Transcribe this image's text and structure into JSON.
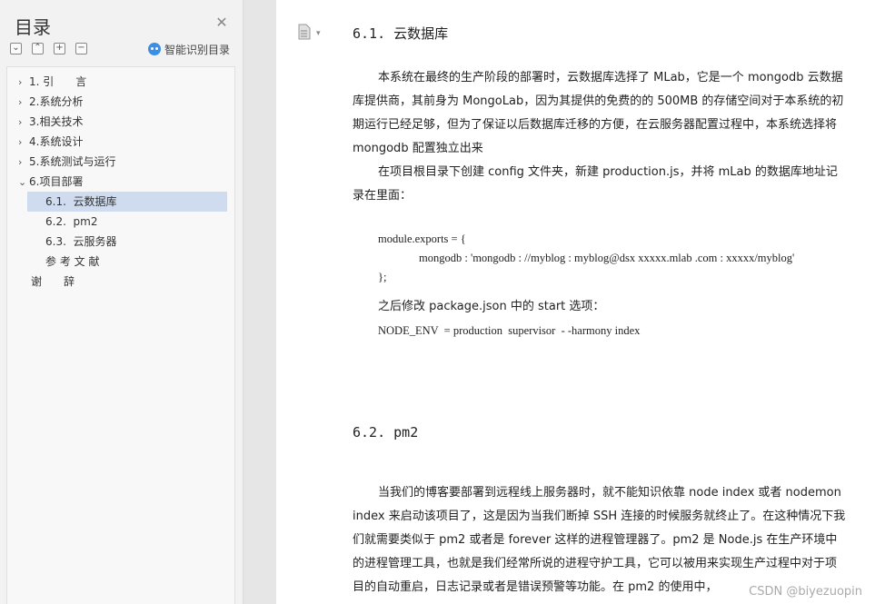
{
  "toc": {
    "title": "目录",
    "smart_label": "智能识别目录",
    "items": [
      {
        "label": "1. 引　　言",
        "level": 0,
        "chevron": "right"
      },
      {
        "label": "2.系统分析",
        "level": 0,
        "chevron": "right"
      },
      {
        "label": "3.相关技术",
        "level": 0,
        "chevron": "right"
      },
      {
        "label": "4.系统设计",
        "level": 0,
        "chevron": "right"
      },
      {
        "label": "5.系统测试与运行",
        "level": 0,
        "chevron": "right"
      },
      {
        "label": "6.项目部署",
        "level": 0,
        "chevron": "down"
      },
      {
        "label": "6.1.  云数据库",
        "level": 1,
        "selected": true
      },
      {
        "label": "6.2.  pm2",
        "level": 1
      },
      {
        "label": "6.3.  云服务器",
        "level": 1
      },
      {
        "label": "参 考 文 献",
        "level": 1
      },
      {
        "label": "谢　　辞",
        "level": 0
      }
    ]
  },
  "doc": {
    "h1": "6.1.  云数据库",
    "p1": "本系统在最终的生产阶段的部署时，云数据库选择了 MLab，它是一个 mongodb 云数据库提供商，其前身为 MongoLab，因为其提供的免费的的 500MB 的存储空间对于本系统的初期运行已经足够，但为了保证以后数据库迁移的方便，在云服务器配置过程中，本系统选择将 mongodb 配置独立出来",
    "p2": "在项目根目录下创建 config 文件夹，新建 production.js，并将 mLab 的数据库地址记录在里面：",
    "code1": "module.exports = {",
    "code2": "mongodb : 'mongodb : //myblog : myblog@dsx xxxxx.mlab .com : xxxxx/myblog'",
    "code3": "};",
    "p3": "之后修改 package.json 中的 start 选项：",
    "code4": "NODE_ENV  = production  supervisor  - -harmony index",
    "h2": "6.2.  pm2",
    "p4": "当我们的博客要部署到远程线上服务器时，就不能知识依靠 node index 或者 nodemon index 来启动该项目了，这是因为当我们断掉 SSH 连接的时候服务就终止了。在这种情况下我们就需要类似于 pm2 或者是 forever 这样的进程管理器了。pm2 是 Node.js 在生产环境中的进程管理工具，也就是我们经常所说的进程守护工具，它可以被用来实现生产过程中对于项目的自动重启，日志记录或者是错误预警等功能。在 pm2 的使用中，",
    "watermark": "CSDN @biyezuopin"
  }
}
